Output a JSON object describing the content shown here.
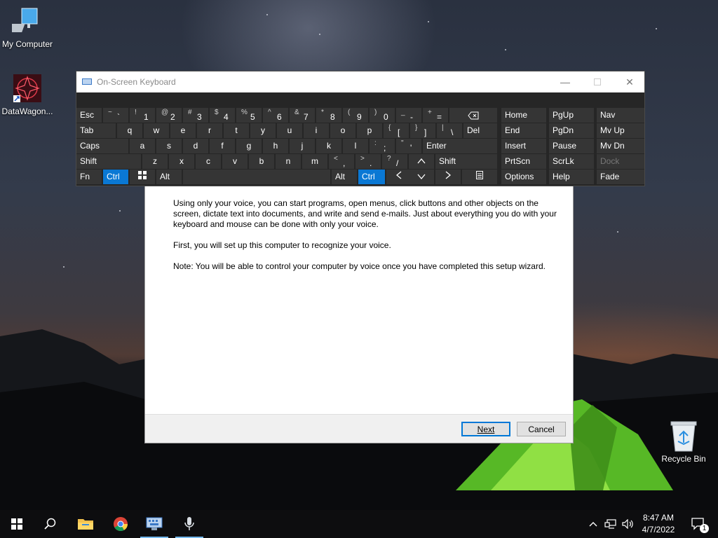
{
  "desktop": {
    "icons": [
      {
        "label": "My Computer"
      },
      {
        "label": "DataWagon..."
      },
      {
        "label": "Recycle Bin"
      }
    ]
  },
  "osk": {
    "title": "On-Screen Keyboard",
    "row1": {
      "esc": "Esc",
      "num_keys": [
        {
          "shift": "~",
          "main": "`"
        },
        {
          "shift": "!",
          "main": "1"
        },
        {
          "shift": "@",
          "main": "2"
        },
        {
          "shift": "#",
          "main": "3"
        },
        {
          "shift": "$",
          "main": "4"
        },
        {
          "shift": "%",
          "main": "5"
        },
        {
          "shift": "^",
          "main": "6"
        },
        {
          "shift": "&",
          "main": "7"
        },
        {
          "shift": "*",
          "main": "8"
        },
        {
          "shift": "(",
          "main": "9"
        },
        {
          "shift": ")",
          "main": "0"
        },
        {
          "shift": "_",
          "main": "-"
        },
        {
          "shift": "+",
          "main": "="
        }
      ]
    },
    "row2": {
      "tab": "Tab",
      "letters": [
        "q",
        "w",
        "e",
        "r",
        "t",
        "y",
        "u",
        "i",
        "o",
        "p"
      ],
      "brackets": [
        {
          "shift": "{",
          "main": "["
        },
        {
          "shift": "}",
          "main": "]"
        },
        {
          "shift": "|",
          "main": "\\"
        }
      ],
      "del": "Del"
    },
    "row3": {
      "caps": "Caps",
      "letters": [
        "a",
        "s",
        "d",
        "f",
        "g",
        "h",
        "j",
        "k",
        "l"
      ],
      "punct": [
        {
          "shift": ":",
          "main": ";"
        },
        {
          "shift": "\"",
          "main": "'"
        }
      ],
      "enter": "Enter"
    },
    "row4": {
      "shift_left": "Shift",
      "letters": [
        "z",
        "x",
        "c",
        "v",
        "b",
        "n",
        "m"
      ],
      "punct": [
        {
          "shift": "<",
          "main": ","
        },
        {
          "shift": ">",
          "main": "."
        },
        {
          "shift": "?",
          "main": "/"
        }
      ],
      "shift_right": "Shift"
    },
    "row5": {
      "fn": "Fn",
      "ctrl_left": "Ctrl",
      "alt_left": "Alt",
      "alt_right": "Alt",
      "ctrl_right": "Ctrl"
    },
    "nav_block": {
      "col1": [
        "Home",
        "End",
        "Insert",
        "PrtScn",
        "Options"
      ],
      "col2": [
        "PgUp",
        "PgDn",
        "Pause",
        "ScrLk",
        "Help"
      ],
      "col3": [
        "Nav",
        "Mv Up",
        "Mv Dn",
        "Dock",
        "Fade"
      ]
    },
    "accent_color": "#0a78d4"
  },
  "wizard": {
    "paragraphs": [
      "Using only your voice, you can start programs, open menus, click buttons and other objects on the screen, dictate text into documents, and write and send e-mails. Just about everything you do with your keyboard and mouse can be done with only your voice.",
      "First, you will set up this computer to recognize your voice.",
      "Note: You will be able to control your computer by voice once you have completed this setup wizard."
    ],
    "next_label": "Next",
    "cancel_label": "Cancel"
  },
  "taskbar": {
    "items": [
      "start-icon",
      "search-icon",
      "file-explorer-icon",
      "chrome-icon",
      "on-screen-keyboard-icon",
      "speech-recognition-icon"
    ],
    "time": "8:47 AM",
    "date": "4/7/2022",
    "notification_count": "1"
  }
}
